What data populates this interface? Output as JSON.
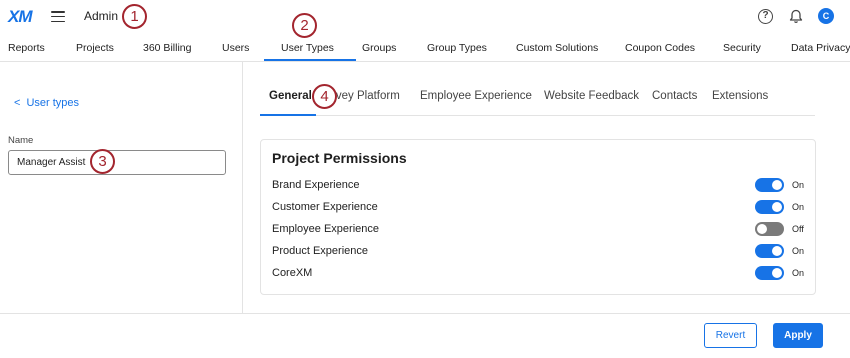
{
  "topbar": {
    "logo": "XM",
    "title": "Admin",
    "help_glyph": "?",
    "avatar_initial": "C"
  },
  "nav": {
    "items": [
      "Reports",
      "Projects",
      "360 Billing",
      "Users",
      "User Types",
      "Groups",
      "Group Types",
      "Custom Solutions",
      "Coupon Codes",
      "Security",
      "Data Privacy"
    ],
    "active": "User Types"
  },
  "left_panel": {
    "back_chevron": "<",
    "back_link": "User types",
    "name_label": "Name",
    "name_value": "Manager Assist"
  },
  "subtabs": {
    "items": [
      "General",
      "Survey Platform",
      "Employee Experience",
      "Website Feedback",
      "Contacts",
      "Extensions"
    ],
    "active": "General"
  },
  "permissions": {
    "title": "Project Permissions",
    "rows": [
      {
        "label": "Brand Experience",
        "state": "On"
      },
      {
        "label": "Customer Experience",
        "state": "On"
      },
      {
        "label": "Employee Experience",
        "state": "Off"
      },
      {
        "label": "Product Experience",
        "state": "On"
      },
      {
        "label": "CoreXM",
        "state": "On"
      }
    ]
  },
  "footer": {
    "revert_label": "Revert",
    "apply_label": "Apply"
  },
  "callouts": [
    "1",
    "2",
    "3",
    "4"
  ],
  "colors": {
    "accent": "#1773e6",
    "toggle_off": "#7a7a7a",
    "callout": "#a3252e"
  }
}
